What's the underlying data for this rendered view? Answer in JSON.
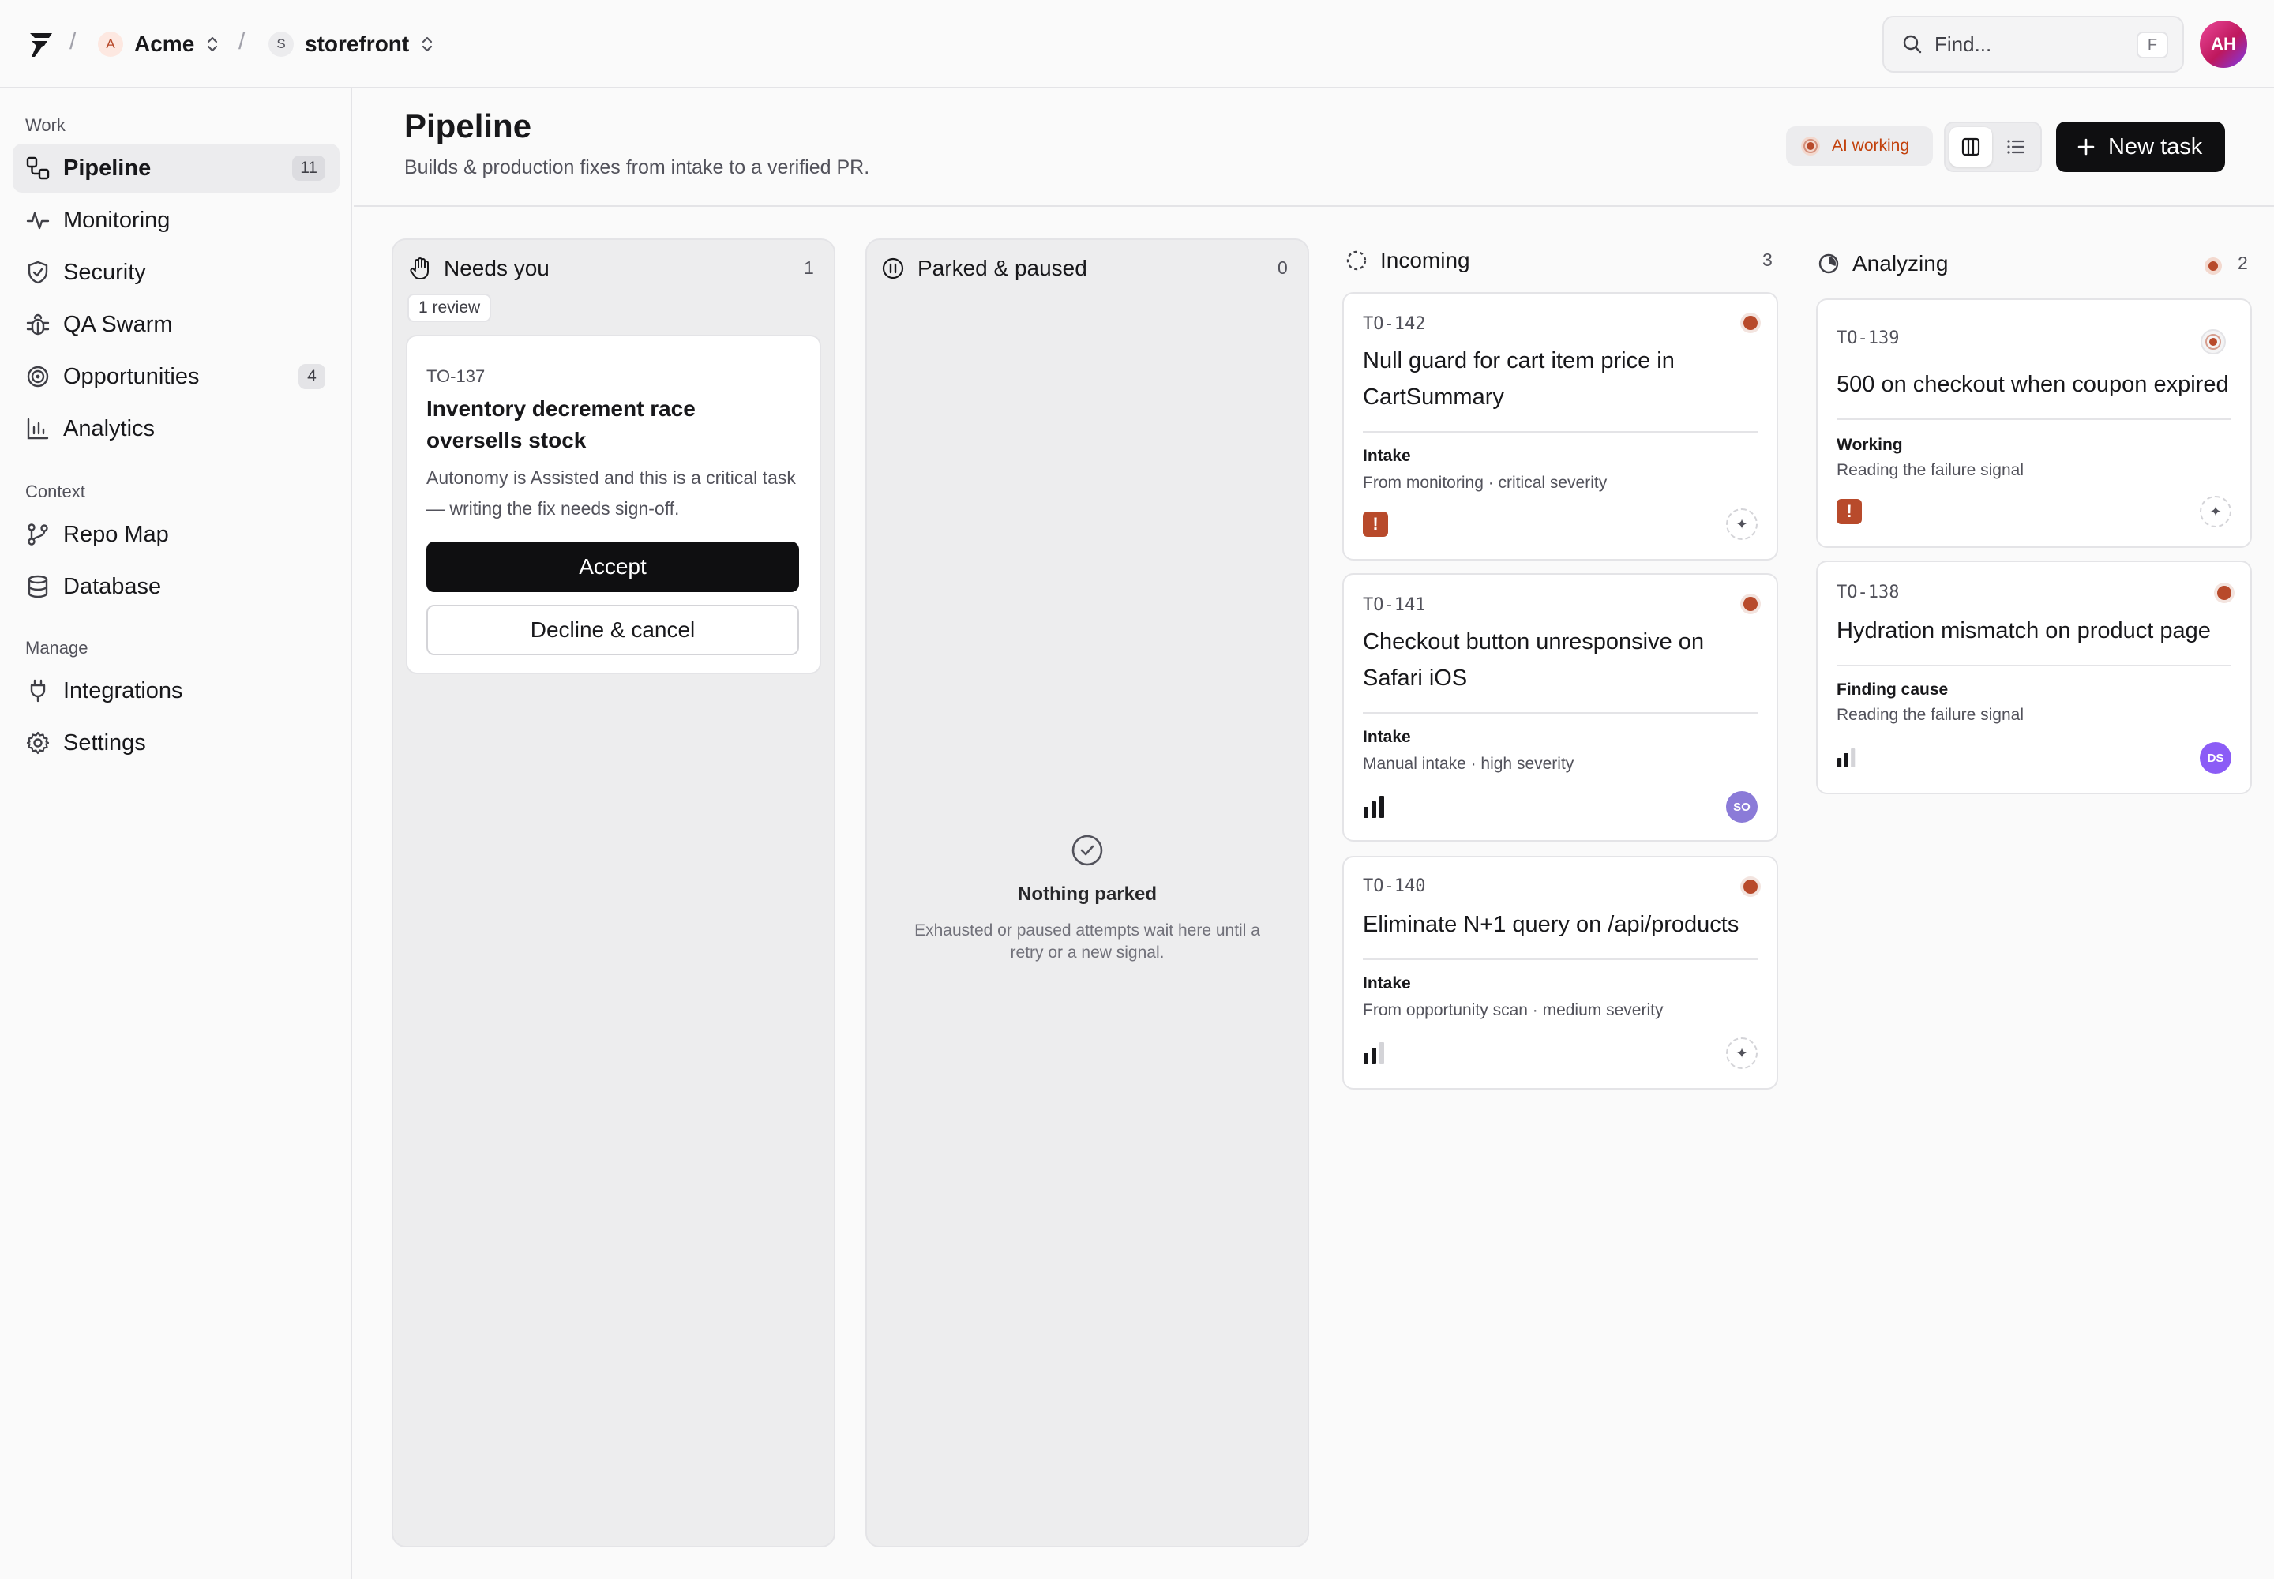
{
  "topbar": {
    "org": {
      "initial": "A",
      "name": "Acme"
    },
    "project": {
      "initial": "S",
      "name": "storefront"
    },
    "search": {
      "placeholder": "Find...",
      "shortcut": "F"
    },
    "user_initials": "AH"
  },
  "sidebar": {
    "sections": [
      {
        "label": "Work"
      },
      {
        "label": "Context"
      },
      {
        "label": "Manage"
      }
    ],
    "items": [
      {
        "label": "Pipeline",
        "count": "11",
        "icon": "pipeline-icon",
        "active": true
      },
      {
        "label": "Monitoring",
        "icon": "pulse-icon"
      },
      {
        "label": "Security",
        "icon": "shield-icon"
      },
      {
        "label": "QA Swarm",
        "icon": "bug-icon"
      },
      {
        "label": "Opportunities",
        "count": "4",
        "icon": "target-icon"
      },
      {
        "label": "Analytics",
        "icon": "bar-chart-icon"
      },
      {
        "label": "Repo Map",
        "icon": "git-branch-icon"
      },
      {
        "label": "Database",
        "icon": "database-icon"
      },
      {
        "label": "Integrations",
        "icon": "plug-icon"
      },
      {
        "label": "Settings",
        "icon": "gear-icon"
      }
    ]
  },
  "header": {
    "title": "Pipeline",
    "subtitle": "Builds & production fixes from intake to a verified PR.",
    "ai_status": "AI working",
    "new_task_label": "New task"
  },
  "columns": [
    {
      "title": "Needs you",
      "count": "1",
      "tag": "1 review",
      "cards": [
        {
          "id": "TO-137",
          "title": "Inventory decrement race oversells stock",
          "description": "Autonomy is Assisted and this is a critical task — writing the fix needs sign-off.",
          "accept_label": "Accept",
          "decline_label": "Decline & cancel"
        }
      ]
    },
    {
      "title": "Parked & paused",
      "count": "0",
      "empty": {
        "title": "Nothing parked",
        "description": "Exhausted or paused attempts wait here until a retry or a new signal."
      }
    },
    {
      "title": "Incoming",
      "count": "3",
      "cards": [
        {
          "id": "TO-142",
          "title": "Null guard for cart item price in CartSummary",
          "stage": "Intake",
          "detail": "From monitoring · critical severity",
          "severity": "critical",
          "assignee": "agent"
        },
        {
          "id": "TO-141",
          "title": "Checkout button unresponsive on Safari iOS",
          "stage": "Intake",
          "detail": "Manual intake · high severity",
          "severity": "high",
          "assignee": "SO"
        },
        {
          "id": "TO-140",
          "title": "Eliminate N+1 query on /api/products",
          "stage": "Intake",
          "detail": "From opportunity scan · medium severity",
          "severity": "medium",
          "assignee": "agent"
        }
      ]
    },
    {
      "title": "Analyzing",
      "count": "2",
      "cards": [
        {
          "id": "TO-139",
          "title": "500 on checkout when coupon expired",
          "stage": "Working",
          "detail": "Reading the failure signal",
          "severity": "critical",
          "assignee": "agent"
        },
        {
          "id": "TO-138",
          "title": "Hydration mismatch on product page",
          "stage": "Finding cause",
          "detail": "Reading the failure signal",
          "severity": "medium",
          "assignee": "DS"
        }
      ]
    }
  ],
  "colors": {
    "accent": "#b84a2b",
    "primary_button": "#0f0f11",
    "avatar_purple": "#8b7bd8"
  }
}
